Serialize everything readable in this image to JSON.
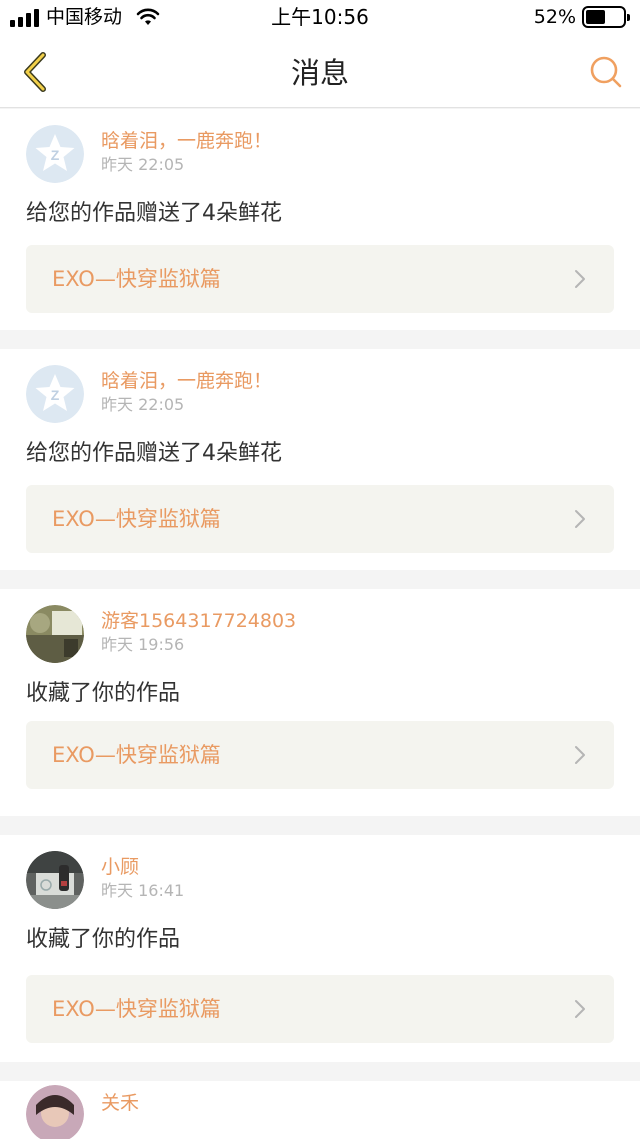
{
  "status_bar": {
    "carrier": "中国移动",
    "time": "上午10:56",
    "battery_percent": "52%",
    "battery_level": 0.52
  },
  "nav": {
    "title": "消息",
    "accent_color": "#e99a62"
  },
  "messages": [
    {
      "username": "晗着泪，一鹿奔跑！",
      "time": "昨天 22:05",
      "action": "给您的作品赠送了4朵鲜花",
      "work_title": "EXO—快穿监狱篇",
      "avatar": "default-qq-avatar"
    },
    {
      "username": "晗着泪，一鹿奔跑！",
      "time": "昨天 22:05",
      "action": "给您的作品赠送了4朵鲜花",
      "work_title": "EXO—快穿监狱篇",
      "avatar": "default-qq-avatar"
    },
    {
      "username": "游客1564317724803",
      "time": "昨天 19:56",
      "action": "收藏了你的作品",
      "work_title": "EXO—快穿监狱篇",
      "avatar": "photo-avatar-room"
    },
    {
      "username": "小顾",
      "time": "昨天 16:41",
      "action": "收藏了你的作品",
      "work_title": "EXO—快穿监狱篇",
      "avatar": "photo-avatar-bottle"
    },
    {
      "username": "关禾",
      "time": "",
      "action": "",
      "work_title": "",
      "avatar": "photo-avatar-person"
    }
  ]
}
